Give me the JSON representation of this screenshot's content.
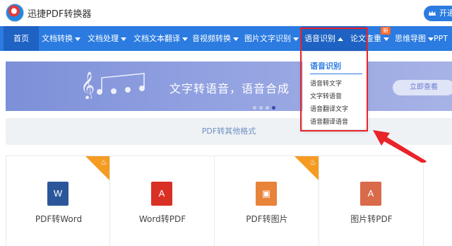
{
  "header": {
    "app_title": "迅捷PDF转换器",
    "login_label": "开通"
  },
  "nav": {
    "home": "首页",
    "items": [
      "文档转换",
      "文档处理",
      "文档文本翻译",
      "音视频转换",
      "图片文字识别",
      "语音识别",
      "论文查重",
      "思维导图",
      "PPT"
    ],
    "new_badge": "新"
  },
  "dropdown": {
    "title": "语音识别",
    "items": [
      "语音转文字",
      "文字转语音",
      "语音翻译文字",
      "语音翻译语音"
    ]
  },
  "banner": {
    "text": "文字转语音，语音合成",
    "button": "立即查看"
  },
  "section": {
    "label": "PDF转其他格式"
  },
  "cards": [
    {
      "label": "PDF转Word",
      "icon": "W",
      "icon_color": "#2b579a",
      "hot": true
    },
    {
      "label": "Word转PDF",
      "icon": "A",
      "icon_color": "#d93025",
      "hot": false
    },
    {
      "label": "PDF转图片",
      "icon": "▣",
      "icon_color": "#e8833a",
      "hot": true
    },
    {
      "label": "图片转PDF",
      "icon": "A",
      "icon_color": "#d96a4a",
      "hot": false
    }
  ],
  "colors": {
    "nav_blue": "#2b7be0",
    "active_blue": "#1e62c3",
    "highlight_red": "#e8232a",
    "hot_orange": "#f59b22"
  }
}
